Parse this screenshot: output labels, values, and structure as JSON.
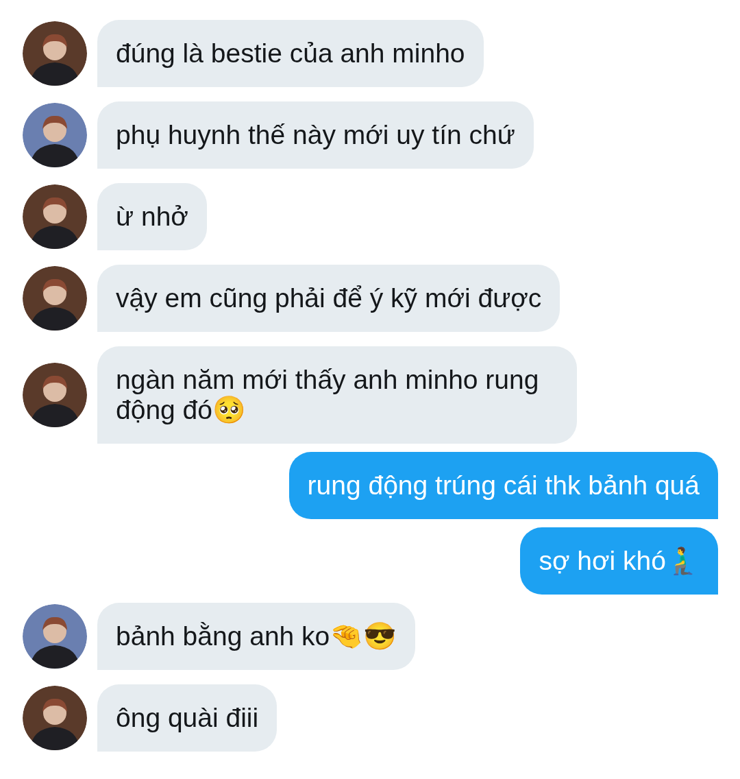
{
  "messages": [
    {
      "kind": "incoming",
      "color": "#5a3a2a",
      "text": "đúng là bestie của anh minho"
    },
    {
      "kind": "incoming",
      "color": "#6a7fb0",
      "text": "phụ huynh thế này mới uy tín chứ"
    },
    {
      "kind": "incoming",
      "color": "#5a3a2a",
      "text": "ừ nhở"
    },
    {
      "kind": "incoming",
      "color": "#5a3a2a",
      "text": "vậy em cũng phải để ý kỹ mới được"
    },
    {
      "kind": "incoming",
      "color": "#5a3a2a",
      "text": "ngàn năm mới thấy anh minho rung động đó🥺"
    },
    {
      "kind": "outgoing",
      "text": "rung động trúng cái thk bảnh quá"
    },
    {
      "kind": "outgoing",
      "text": "sợ hơi khó🧎‍♂️"
    },
    {
      "kind": "incoming",
      "color": "#6a7fb0",
      "text": "bảnh bằng anh ko🤏😎"
    },
    {
      "kind": "incoming",
      "color": "#5a3a2a",
      "text": "ông quài điii"
    }
  ]
}
